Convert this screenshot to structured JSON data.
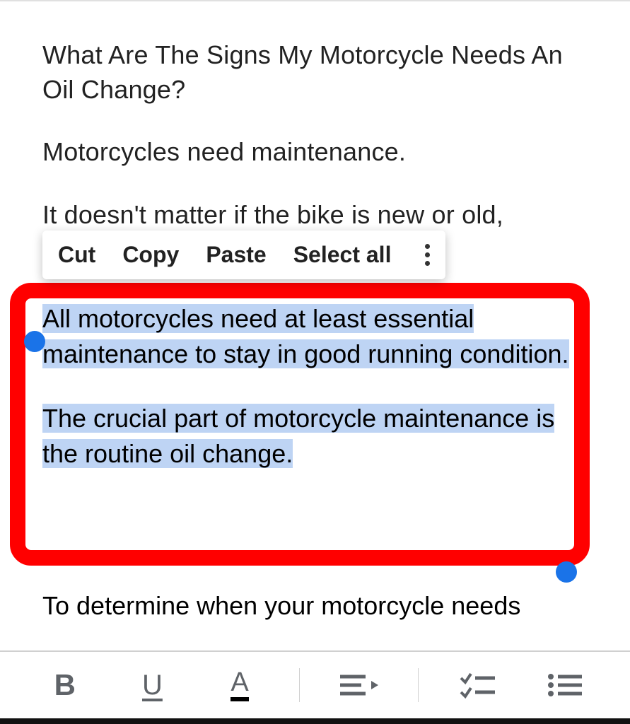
{
  "document": {
    "title": "What Are The Signs My Motorcycle Needs An Oil Change?",
    "para1": "Motorcycles need maintenance.",
    "para2_partial": "It doesn't matter if the bike is new or old,",
    "highlighted_para1": "All motorcycles need at least essential maintenance to stay in good running condition.",
    "highlighted_para2": "The crucial part of motorcycle maintenance is the routine oil change.",
    "after_highlight": "To determine when your motorcycle needs"
  },
  "context_menu": {
    "cut": "Cut",
    "copy": "Copy",
    "paste": "Paste",
    "select_all": "Select all"
  },
  "toolbar": {
    "bold": "B",
    "underline": "U",
    "text_color": "A"
  }
}
